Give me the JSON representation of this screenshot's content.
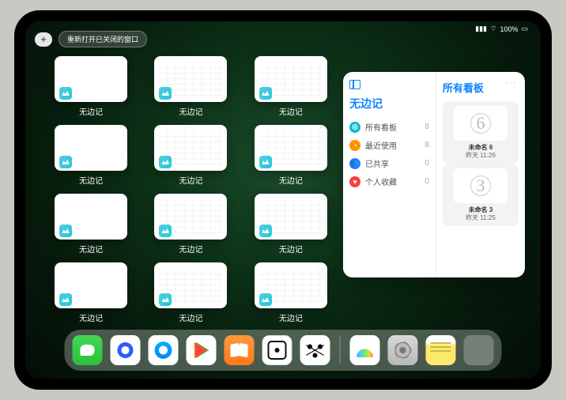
{
  "status": {
    "battery": "100%",
    "wifi_icon": "wifi-icon",
    "signal_icon": "signal-icon"
  },
  "top": {
    "add_label": "+",
    "reopen_label": "重新打开已关闭的窗口"
  },
  "app_name": "无边记",
  "windows": [
    {
      "label": "无边记",
      "style": "blank"
    },
    {
      "label": "无边记",
      "style": "grid"
    },
    {
      "label": "无边记",
      "style": "grid"
    },
    {
      "label": "无边记",
      "style": "blank"
    },
    {
      "label": "无边记",
      "style": "grid"
    },
    {
      "label": "无边记",
      "style": "grid"
    },
    {
      "label": "无边记",
      "style": "blank"
    },
    {
      "label": "无边记",
      "style": "grid"
    },
    {
      "label": "无边记",
      "style": "grid"
    },
    {
      "label": "无边记",
      "style": "blank"
    },
    {
      "label": "无边记",
      "style": "grid"
    },
    {
      "label": "无边记",
      "style": "grid"
    }
  ],
  "panel": {
    "title": "无边记",
    "right_title": "所有看板",
    "ellipsis": "···",
    "items": [
      {
        "icon": "cyan",
        "glyph": "◎",
        "label": "所有看板",
        "count": 8
      },
      {
        "icon": "orange",
        "glyph": "◔",
        "label": "最近使用",
        "count": 8
      },
      {
        "icon": "blue",
        "glyph": "👥",
        "label": "已共享",
        "count": 0
      },
      {
        "icon": "red",
        "glyph": "♥",
        "label": "个人收藏",
        "count": 0
      }
    ],
    "boards": [
      {
        "glyph": "6",
        "title": "未命名 6",
        "time": "昨天 11:26"
      },
      {
        "glyph": "3",
        "title": "未命名 3",
        "time": "昨天 11:25"
      }
    ]
  },
  "dock": [
    {
      "name": "wechat",
      "cls": "di-wechat"
    },
    {
      "name": "quark",
      "cls": "di-quark"
    },
    {
      "name": "qqbrowser",
      "cls": "di-qqbrowser"
    },
    {
      "name": "play",
      "cls": "di-play"
    },
    {
      "name": "books",
      "cls": "di-books"
    },
    {
      "name": "dice",
      "cls": "di-dice"
    },
    {
      "name": "nodes",
      "cls": "di-nodes"
    },
    {
      "name": "sep"
    },
    {
      "name": "freeform",
      "cls": "di-freeform"
    },
    {
      "name": "settings",
      "cls": "di-settings"
    },
    {
      "name": "notes",
      "cls": "di-notes"
    },
    {
      "name": "app-folder",
      "cls": "di-folder"
    }
  ]
}
